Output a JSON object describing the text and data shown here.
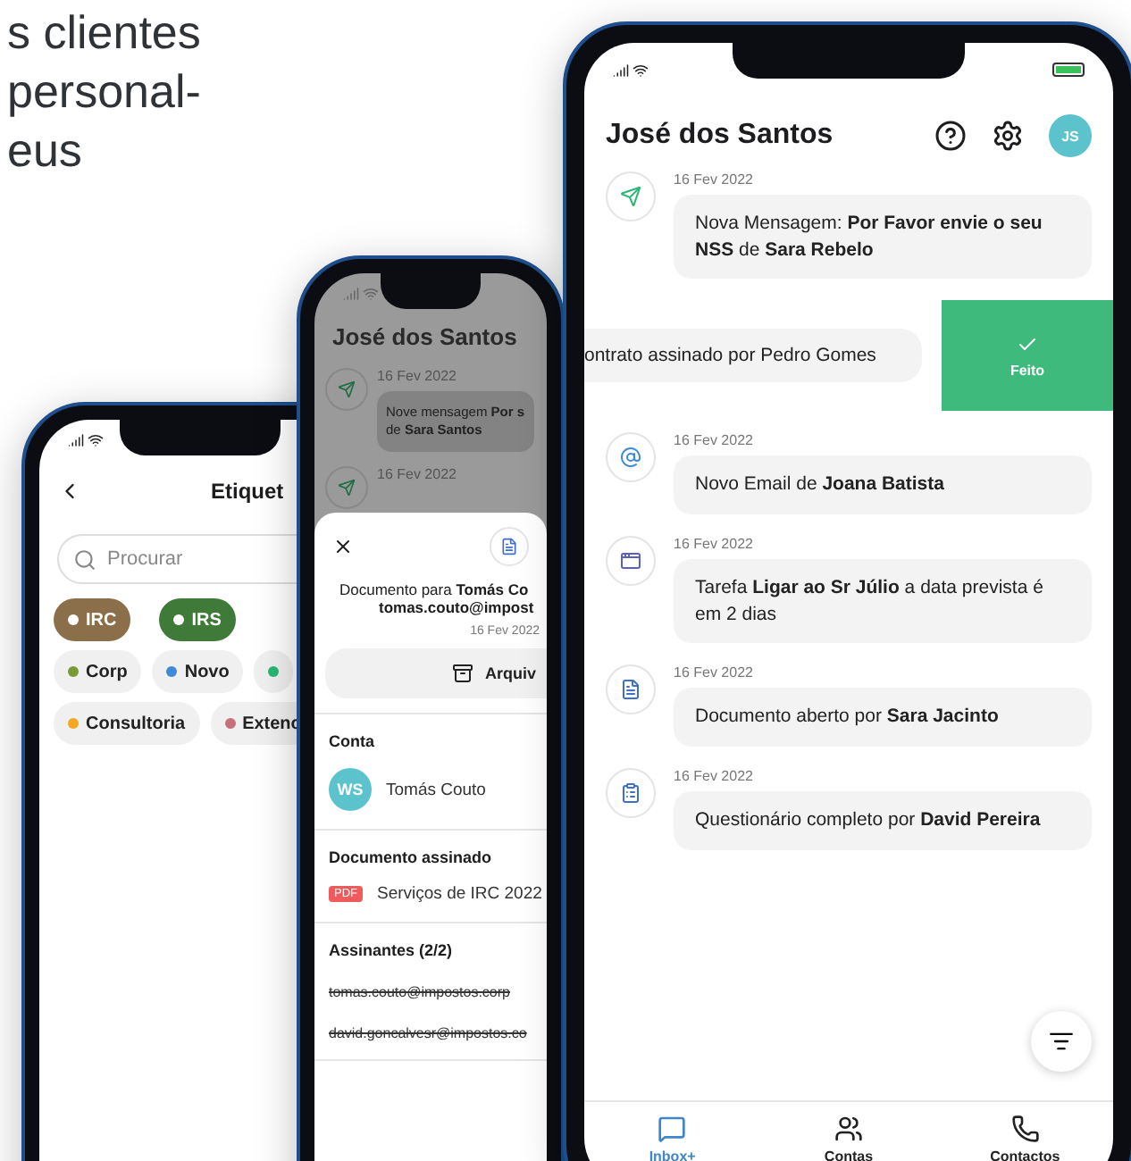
{
  "headline": [
    "s clientes",
    "personal-",
    "eus"
  ],
  "tags_phone": {
    "title": "Etiquet",
    "search": {
      "placeholder": "Procurar"
    },
    "tag_rows": [
      [
        {
          "label": "IRC",
          "color": "#8b6f4a",
          "selected": true
        },
        {
          "label": "IRS",
          "color": "#3f7a38",
          "selected": true
        }
      ],
      [
        {
          "label": "Corp",
          "color": "#7a9a36",
          "selected": false
        },
        {
          "label": "Novo",
          "color": "#3f8ad8",
          "selected": false
        },
        {
          "color": "#2bb673",
          "selected": false
        }
      ],
      [
        {
          "label": "Consultoria",
          "color": "#f5a623",
          "selected": false
        },
        {
          "label": "Extenc",
          "color": "#c8707a",
          "selected": false
        }
      ]
    ]
  },
  "document_phone": {
    "background": {
      "title": "José dos Santos",
      "items": [
        {
          "date": "16 Fev 2022",
          "lines": [
            "Nove mensagem **Por s**",
            "de **Sara Santos**"
          ]
        },
        {
          "date": "16 Fev 2022"
        }
      ]
    },
    "sheet": {
      "title": "Documento para **Tomás Co**",
      "email": "tomas.couto@impost",
      "date": "16 Fev 2022",
      "archive_button": "Arquiv",
      "account": {
        "heading": "Conta",
        "initials": "WS",
        "name": "Tomás Couto"
      },
      "signed": {
        "heading": "Documento assinado",
        "badge": "PDF",
        "name": "Serviços de IRC 2022"
      },
      "signers": {
        "heading": "Assinantes (2/2)",
        "emails": [
          "tomas.couto@impostos.corp",
          "david.goncalvesr@impostos.co"
        ]
      }
    }
  },
  "inbox_phone": {
    "title": "José dos Santos",
    "initials": "JS",
    "feed": [
      {
        "kind": "message",
        "date": "16 Fev 2022",
        "text": "Nova Mensagem: **Por Favor envie o seu NSS** de **Sara Rebelo**"
      },
      {
        "kind": "swiped",
        "text": "ontrato assinado por Pedro Gomes",
        "action": "Feito"
      },
      {
        "kind": "email",
        "date": "16 Fev 2022",
        "text": "Novo Email de **Joana Batista**"
      },
      {
        "kind": "task",
        "date": "16 Fev 2022",
        "text": "Tarefa **Ligar ao Sr Júlio** a data prevista é em 2 dias"
      },
      {
        "kind": "document",
        "date": "16 Fev 2022",
        "text": "Documento aberto por **Sara Jacinto**"
      },
      {
        "kind": "form",
        "date": "16 Fev 2022",
        "text": "Questionário completo por **David Pereira**"
      }
    ],
    "nav": [
      {
        "kind": "inbox",
        "label": "Inbox+",
        "selected": true
      },
      {
        "kind": "accounts",
        "label": "Contas",
        "selected": false
      },
      {
        "kind": "contacts",
        "label": "Contactos",
        "selected": false
      }
    ]
  }
}
